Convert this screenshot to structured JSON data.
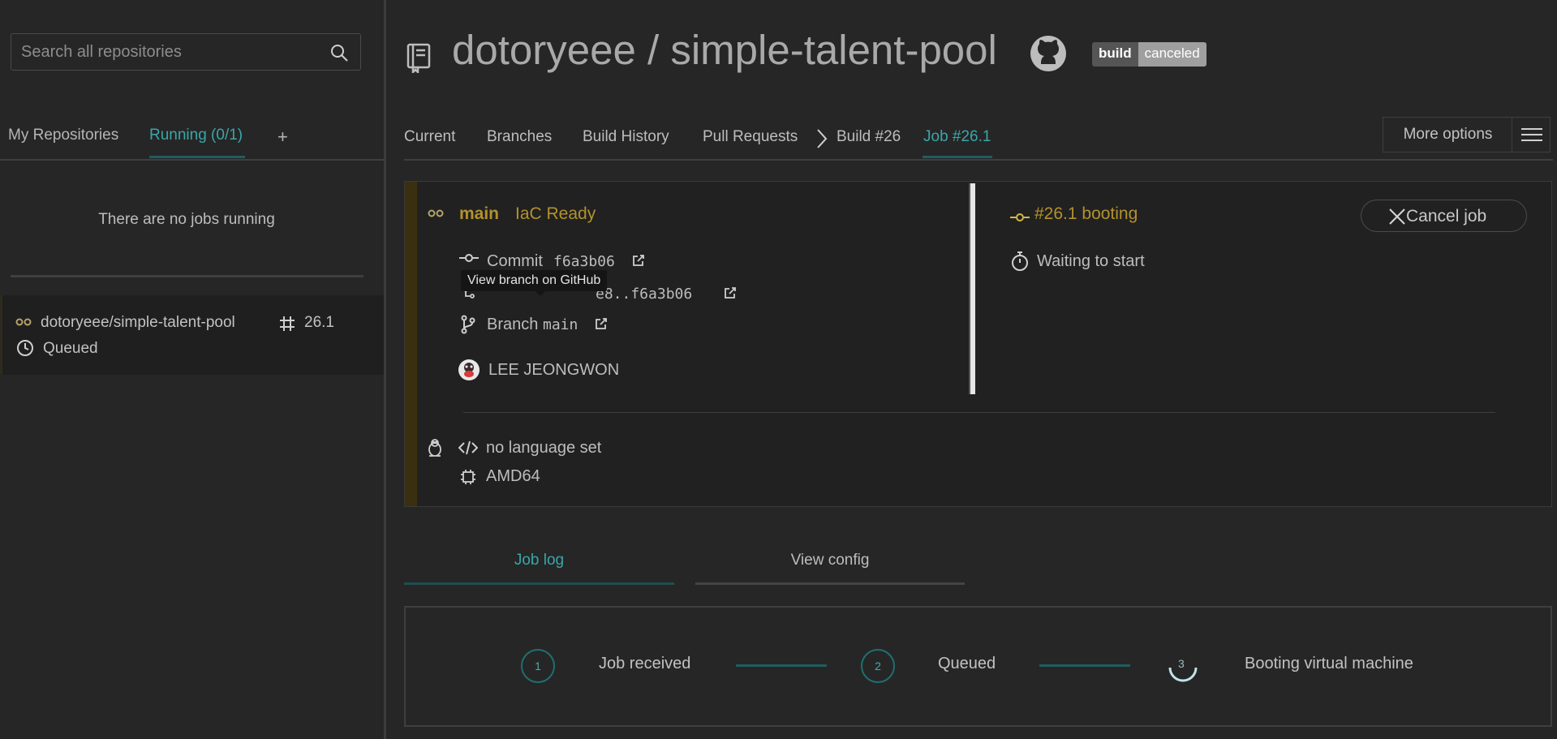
{
  "search": {
    "placeholder": "Search all repositories"
  },
  "sidebar": {
    "tabs": [
      {
        "label": "My Repositories"
      },
      {
        "label": "Running (0/1)"
      }
    ],
    "add_label": "+",
    "empty_message": "There are no jobs running",
    "job": {
      "repo": "dotoryeee/simple-talent-pool",
      "number": "26.1",
      "status": "Queued"
    }
  },
  "header": {
    "title": "dotoryeee / simple-talent-pool",
    "badge": {
      "left": "build",
      "right": "canceled"
    }
  },
  "nav": {
    "items": [
      "Current",
      "Branches",
      "Build History",
      "Pull Requests"
    ],
    "build": "Build #26",
    "job": "Job #26.1",
    "more_options": "More options"
  },
  "job": {
    "branch": "main",
    "commit_message": "IaC Ready",
    "commit_label": "Commit",
    "commit_sha": "f6a3b06",
    "compare_range": "e8..f6a3b06",
    "branch_label": "Branch",
    "branch_value": "main",
    "author": "LEE JEONGWON",
    "tooltip": "View branch on GitHub",
    "state": "#26.1 booting",
    "waiting": "Waiting to start",
    "cancel_label": "Cancel job",
    "language": "no language set",
    "arch": "AMD64"
  },
  "log_tabs": [
    "Job log",
    "View config"
  ],
  "steps": [
    {
      "number": "1",
      "label": "Job received"
    },
    {
      "number": "2",
      "label": "Queued"
    },
    {
      "number": "3",
      "label": "Booting virtual machine"
    }
  ],
  "colors": {
    "accent": "#3aa6a9",
    "branch": "#b2922c",
    "background": "#262626"
  }
}
